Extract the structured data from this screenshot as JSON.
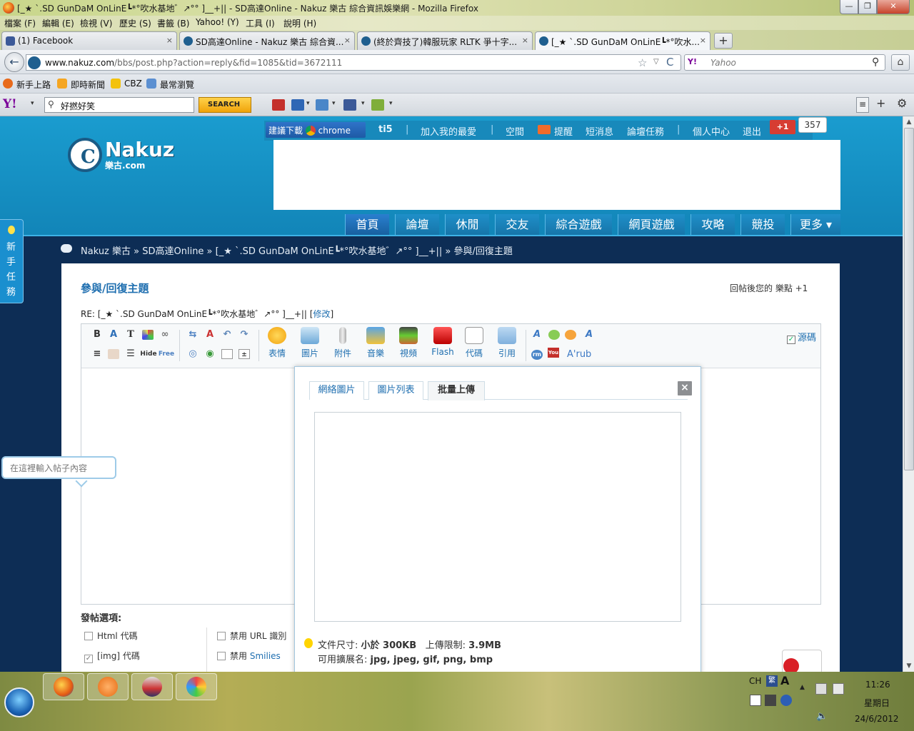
{
  "window": {
    "title": "[_★ `.SD GunDaM OnLinE┗*°吹水基地゛↗°° ]__+|| - SD高達Online - Nakuz 樂古 綜合資訊娛樂網 - Mozilla Firefox",
    "min": "—",
    "max": "❐",
    "close": "✕"
  },
  "menu": [
    "檔案 (F)",
    "編輯 (E)",
    "檢視 (V)",
    "歷史 (S)",
    "書籤 (B)",
    "Yahoo! (Y)",
    "工具 (I)",
    "說明 (H)"
  ],
  "tabs": [
    {
      "label": "(1) Facebook",
      "icon_color": "#3b5998"
    },
    {
      "label": "SD高達Online - Nakuz 樂古 綜合資...",
      "icon_color": "#1f5f8f"
    },
    {
      "label": "(終於齊技了)韓服玩家 RLTK 爭十字...",
      "icon_color": "#1f5f8f"
    },
    {
      "label": "[_★ `.SD GunDaM OnLinE┗*°吹水...",
      "icon_color": "#1f5f8f"
    }
  ],
  "tab_close": "×",
  "new_tab": "+",
  "nav": {
    "url_host": "www.nakuz.com",
    "url_path": "/bbs/post.php?action=reply&fid=1085&tid=3672111",
    "search_engine": "Y!",
    "search_placeholder": "Yahoo",
    "back": "←",
    "star": "☆",
    "dropdown": "▽",
    "reload": "C",
    "search_icon": "⚲",
    "home": "⌂"
  },
  "bookmarks": [
    "新手上路",
    "即時新聞",
    "CBZ",
    "最常瀏覽"
  ],
  "yahoo_toolbar": {
    "logo": "Y!",
    "search_value": "好撚好笑",
    "search_button": "SEARCH",
    "mag": "⚲",
    "menu_icon": "≡",
    "plus_icon": "+",
    "gear_icon": "⚙"
  },
  "site_top": {
    "promo_label": "建議下載",
    "promo_brand": "chrome",
    "username": "ti5",
    "links": [
      "加入我的最愛",
      "空間",
      "提醒",
      "短消息",
      "論壇任務",
      "個人中心",
      "退出"
    ],
    "gplus": "+1",
    "gplus_count": "357"
  },
  "logo": {
    "name": "Nakuz",
    "sub": "樂古.com",
    "mark": "C"
  },
  "main_nav": [
    "首頁",
    "論壇",
    "休閒",
    "交友",
    "綜合遊戲",
    "網頁遊戲",
    "攻略",
    "競投",
    "更多 ▾"
  ],
  "breadcrumb": "Nakuz 樂古 » SD高達Online » [_★ `.SD GunDaM OnLinE┗*°吹水基地゛↗°° ]__+|| » 參與/回復主題",
  "panel": {
    "title": "參與/回復主題",
    "points_note": "回帖後您的 樂點 +1",
    "subject_prefix": "RE: [_★ `.SD GunDaM OnLinE┗*°吹水基地゛↗°° ]__+|| [",
    "subject_edit": "修改",
    "subject_suffix": "]"
  },
  "editor": {
    "big_buttons": [
      "表情",
      "圖片",
      "附件",
      "音樂",
      "視頻",
      "Flash",
      "代碼",
      "引用"
    ],
    "source_label": "源碼",
    "source_checked": "✓",
    "placeholder": "在這裡輸入帖子內容",
    "rub": "rub"
  },
  "post_options": {
    "title": "發帖選項:",
    "items": [
      {
        "label": "Html 代碼",
        "checked": false
      },
      {
        "label": "[img] 代碼",
        "checked": true
      },
      {
        "label": "禁用 URL 識別",
        "checked": false
      },
      {
        "label": "禁用",
        "link": "Smilies",
        "checked": false
      }
    ],
    "check_mark": "✓"
  },
  "popup": {
    "tabs": [
      "網絡圖片",
      "圖片列表",
      "批量上傳"
    ],
    "active_tab": 2,
    "close": "×",
    "hint_size_label": "文件尺寸: ",
    "hint_size": "小於 300KB",
    "hint_limit_label": "上傳限制: ",
    "hint_limit": "3.9MB",
    "hint_ext_label": "可用擴展名: ",
    "hint_ext": "jpg, jpeg, gif, png, bmp"
  },
  "side_tab": "新手任務",
  "taskbar": {
    "lang": "CH",
    "ime_a": "繁",
    "ime_b": "A",
    "time": "11:26",
    "day": "星期日",
    "date": "24/6/2012"
  },
  "colors": {
    "site_blue": "#1a9ccf",
    "page_dark": "#0d2d55",
    "link_blue": "#1f6fb0"
  }
}
